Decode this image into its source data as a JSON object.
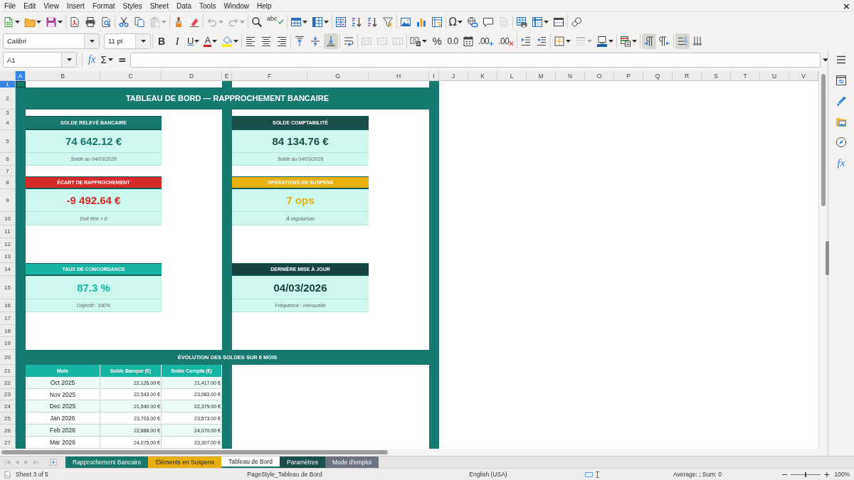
{
  "menu_bar": {
    "items": [
      "File",
      "Edit",
      "View",
      "Insert",
      "Format",
      "Styles",
      "Sheet",
      "Data",
      "Tools",
      "Window",
      "Help"
    ],
    "close": "×"
  },
  "standard_toolbar": [
    {
      "disabled": false
    },
    {
      "disabled": false
    },
    {
      "disabled": false
    },
    {
      "disabled": false
    },
    {
      "disabled": false
    },
    {
      "disabled": false
    },
    {
      "disabled": false
    },
    {
      "disabled": false
    },
    {
      "disabled": true
    },
    {
      "disabled": false
    },
    {
      "disabled": false
    },
    {
      "disabled": true
    },
    {
      "disabled": true
    },
    {
      "disabled": false
    },
    {
      "label": "abc",
      "disabled": false
    },
    {
      "disabled": false
    },
    {
      "disabled": false
    },
    {
      "disabled": false
    },
    {
      "disabled": false
    },
    {
      "disabled": false
    },
    {
      "disabled": false
    },
    {
      "disabled": false
    },
    {
      "disabled": false
    },
    {
      "disabled": false
    },
    {
      "label": "Ω",
      "disabled": false
    },
    {
      "disabled": false
    },
    {
      "disabled": false
    },
    {
      "disabled": true
    },
    {
      "disabled": false
    },
    {
      "disabled": false
    },
    {
      "disabled": false
    },
    {
      "disabled": false
    }
  ],
  "formatting_toolbar": {
    "font_name": "Calibri",
    "font_size": "11 pt",
    "buttons": [
      {
        "label": "B",
        "on": false,
        "disabled": false
      },
      {
        "label": "I",
        "on": false,
        "disabled": false
      },
      {
        "label": "U",
        "on": false,
        "disabled": false
      },
      {
        "label": "A",
        "on": false,
        "disabled": false
      },
      {
        "on": false,
        "disabled": false
      },
      {
        "on": false,
        "disabled": false
      },
      {
        "on": false,
        "disabled": false
      },
      {
        "on": false,
        "disabled": false
      },
      {
        "on": false,
        "disabled": false
      },
      {
        "on": false,
        "disabled": false
      },
      {
        "on": true,
        "disabled": false
      },
      {
        "on": false,
        "disabled": false
      },
      {
        "on": false,
        "disabled": true
      },
      {
        "on": false,
        "disabled": true
      },
      {
        "on": false,
        "disabled": true
      },
      {
        "on": false,
        "disabled": false
      },
      {
        "label": "%",
        "on": false,
        "disabled": false
      },
      {
        "label": "0.0",
        "on": false,
        "disabled": false
      },
      {
        "on": false,
        "disabled": false
      },
      {
        "label": ".00",
        "on": false,
        "disabled": false
      },
      {
        "label": ".00",
        "on": false,
        "disabled": false
      },
      {
        "on": false,
        "disabled": false
      },
      {
        "on": false,
        "disabled": false
      },
      {
        "on": false,
        "disabled": false
      },
      {
        "on": false,
        "disabled": true
      },
      {
        "on": false,
        "disabled": false
      },
      {
        "on": false,
        "disabled": false
      },
      {
        "on": true,
        "disabled": false
      },
      {
        "on": false,
        "disabled": false
      },
      {
        "on": true,
        "disabled": false
      },
      {
        "on": false,
        "disabled": false
      }
    ]
  },
  "formula_bar": {
    "name_box": "A1",
    "function_wizard": "fx",
    "sum": "Σ",
    "equals": "="
  },
  "sidebar": {
    "functions": "fx"
  },
  "sheet": {
    "columns": [
      {
        "label": "A",
        "selected": true
      },
      {
        "label": "B",
        "selected": false
      },
      {
        "label": "C",
        "selected": false
      },
      {
        "label": "D",
        "selected": false
      },
      {
        "label": "E",
        "selected": false
      },
      {
        "label": "F",
        "selected": false
      },
      {
        "label": "G",
        "selected": false
      },
      {
        "label": "H",
        "selected": false
      },
      {
        "label": "I",
        "selected": false
      },
      {
        "label": "J",
        "selected": false
      },
      {
        "label": "K",
        "selected": false
      },
      {
        "label": "L",
        "selected": false
      },
      {
        "label": "M",
        "selected": false
      },
      {
        "label": "N",
        "selected": false
      },
      {
        "label": "O",
        "selected": false
      },
      {
        "label": "P",
        "selected": false
      },
      {
        "label": "Q",
        "selected": false
      },
      {
        "label": "R",
        "selected": false
      },
      {
        "label": "S",
        "selected": false
      },
      {
        "label": "T",
        "selected": false
      },
      {
        "label": "U",
        "selected": false
      },
      {
        "label": "V",
        "selected": false
      }
    ],
    "rows": [
      {
        "label": "1",
        "selected": true
      },
      {
        "label": "2",
        "selected": false
      },
      {
        "label": "3",
        "selected": false
      },
      {
        "label": "4",
        "selected": false
      },
      {
        "label": "5",
        "selected": false
      },
      {
        "label": "6",
        "selected": false
      },
      {
        "label": "7",
        "selected": false
      },
      {
        "label": "8",
        "selected": false
      },
      {
        "label": "9",
        "selected": false
      },
      {
        "label": "10",
        "selected": false
      },
      {
        "label": "11",
        "selected": false
      },
      {
        "label": "12",
        "selected": false
      },
      {
        "label": "13",
        "selected": false
      },
      {
        "label": "14",
        "selected": false
      },
      {
        "label": "15",
        "selected": false
      },
      {
        "label": "16",
        "selected": false
      },
      {
        "label": "17",
        "selected": false
      },
      {
        "label": "18",
        "selected": false
      },
      {
        "label": "19",
        "selected": false
      },
      {
        "label": "20",
        "selected": false
      },
      {
        "label": "21",
        "selected": false
      },
      {
        "label": "22",
        "selected": false
      },
      {
        "label": "23",
        "selected": false
      },
      {
        "label": "24",
        "selected": false
      },
      {
        "label": "25",
        "selected": false
      },
      {
        "label": "26",
        "selected": false
      },
      {
        "label": "27",
        "selected": false
      }
    ],
    "dashboard": {
      "title": "TABLEAU DE BORD — RAPPROCHEMENT BANCAIRE",
      "cards": [
        {
          "title": "SOLDE RELEVÉ BANCAIRE",
          "value": "74 642.12 €",
          "note": "Solde au 04/03/2026",
          "color": "#17776c"
        },
        {
          "title": "SOLDE COMPTABILITÉ",
          "value": "84 134.76 €",
          "note": "Solde au 04/03/2026",
          "color": "#194f49"
        },
        {
          "title": "ÉCART DE RAPPROCHEMENT",
          "value": "-9 492.64 €",
          "note": "Doit être = 0",
          "color": "#d62a2a"
        },
        {
          "title": "OPÉRATIONS EN SUSPENS",
          "value": "7 ops",
          "note": "À régulariser",
          "color": "#e8b00e"
        },
        {
          "title": "TAUX DE CONCORDANCE",
          "value": "87.3 %",
          "note": "Objectif : 100%",
          "color": "#16b5a2"
        },
        {
          "title": "DERNIÈRE MISE À JOUR",
          "value": "04/03/2026",
          "note": "Fréquence : mensuelle",
          "color": "#15433f"
        }
      ],
      "section_title": "ÉVOLUTION DES SOLDES SUR 6 MOIS",
      "table": {
        "columns": [
          "Mois",
          "Solde Banque (€)",
          "Solde Compta (€)"
        ],
        "rows": [
          [
            "Oct 2025",
            "22,126.00 €",
            "21,417.00 €"
          ],
          [
            "Nov 2025",
            "22,543.00 €",
            "23,083.00 €"
          ],
          [
            "Dec 2025",
            "21,540.00 €",
            "22,379.00 €"
          ],
          [
            "Jan 2026",
            "23,703.00 €",
            "23,573.00 €"
          ],
          [
            "Feb 2026",
            "22,888.00 €",
            "24,070.00 €"
          ],
          [
            "Mar 2026",
            "24,075.00 €",
            "23,307.00 €"
          ]
        ]
      }
    }
  },
  "sheet_navigation": [
    {
      "disabled": true
    },
    {
      "disabled": true
    },
    {
      "disabled": true
    },
    {
      "disabled": true
    }
  ],
  "sheet_tabs": [
    {
      "label": "Rapprochement Bancaire",
      "color": "#17776c",
      "selected": false
    },
    {
      "label": "Éléments en Suspens",
      "color": "#e8b00e",
      "selected": false
    },
    {
      "label": "Tableau de Bord",
      "color": "#17776c",
      "selected": true
    },
    {
      "label": "Paramètres",
      "color": "#194f49",
      "selected": false
    },
    {
      "label": "Mode d'emploi",
      "color": "#6b7280",
      "selected": false
    }
  ],
  "status_bar": {
    "sheet": "Sheet 3 of 5",
    "page_style": "PageStyle_Tableau de Bord",
    "language": "English (USA)",
    "selection_summary": "Average: ; Sum: 0",
    "zoom": {
      "minus": "−",
      "plus": "+",
      "level": 0.5,
      "reading": "100%"
    }
  }
}
